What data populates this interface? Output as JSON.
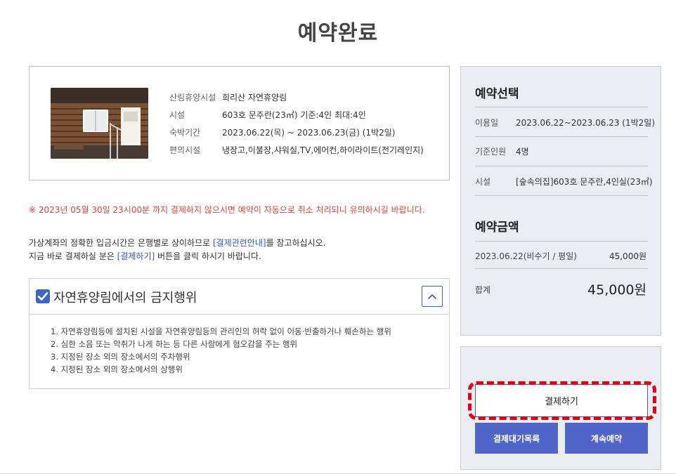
{
  "page": {
    "title": "예약완료"
  },
  "facility": {
    "rows": [
      {
        "label": "산림휴양시설",
        "value": "희리산 자연휴양림"
      },
      {
        "label": "시설",
        "value": "603호 문주란(23㎡) 기준:4인 최대:4인"
      },
      {
        "label": "숙박기간",
        "value": "2023.06.22(목) ~ 2023.06.23(금) (1박2일)"
      },
      {
        "label": "편의시설",
        "value": "냉장고,이불장,샤워실,TV,에어컨,하이라이트(전기레인지)"
      }
    ]
  },
  "notice": {
    "warning": "※ 2023년 05월 30일 23시00분 까지 결제하지 않으시면 예약이 자동으로 취소 처리되니 유의하시길 바랍니다.",
    "line1_pre": "가상계좌의 정확한 입금시간은 은행별로 상이하므로 ",
    "line1_link": "[결제관련안내]",
    "line1_post": "를 참고하십시오.",
    "line2_pre": "지금 바로 결제하실 분은 ",
    "line2_link": "[결제하기]",
    "line2_post": " 버튼을 클릭 하시기 바랍니다."
  },
  "prohibited": {
    "title": "자연휴양림에서의 금지행위",
    "items": [
      "1. 자연휴양림등에 설치된 시설을 자연휴양림등의 관리인의 허락 없이 이동·반출하거나 훼손하는 행위",
      "2. 심한 소음 또는 악취가 나게 하는 등 다른 사람에게 혐오감을 주는 행위",
      "3. 지정된 장소 외의 장소에서의 주차행위",
      "4. 지정된 장소 외의 장소에서의 상행위"
    ]
  },
  "summary": {
    "selection_title": "예약선택",
    "use_date_label": "이용일",
    "use_date_value": "2023.06.22~2023.06.23 (1박2일)",
    "people_label": "기준인원",
    "people_value": "4명",
    "facility_label": "시설",
    "facility_value": "[숲속의집]603호 문주란,4인실(23㎡)",
    "price_title": "예약금액",
    "price_line_label": "2023.06.22(비수기 / 평일)",
    "price_line_value": "45,000원",
    "total_label": "합계",
    "total_value": "45,000원"
  },
  "actions": {
    "pay": "결제하기",
    "wait_list": "결제대기목록",
    "continue": "계속예약"
  },
  "colors": {
    "accent": "#5165c8",
    "warning": "#e0453a",
    "highlight": "#e3000f",
    "panel_bg": "#eaedf2"
  }
}
